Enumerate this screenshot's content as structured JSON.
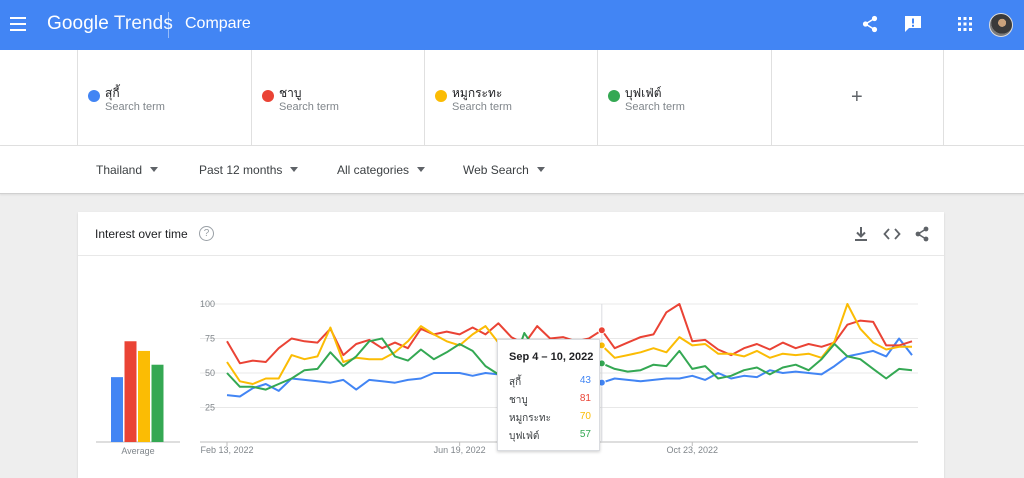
{
  "appbar": {
    "logo_google": "Google",
    "logo_trends": "Trends",
    "title": "Compare"
  },
  "terms": [
    {
      "name": "สุกี้",
      "sub": "Search term",
      "color": "#4285f4"
    },
    {
      "name": "ชาบู",
      "sub": "Search term",
      "color": "#ea4335"
    },
    {
      "name": "หมูกระทะ",
      "sub": "Search term",
      "color": "#fbbc04"
    },
    {
      "name": "บุฟเฟ่ต์",
      "sub": "Search term",
      "color": "#34a853"
    }
  ],
  "add_term_label": "+",
  "filters": {
    "region": "Thailand",
    "period": "Past 12 months",
    "category": "All categories",
    "search_type": "Web Search"
  },
  "card": {
    "title": "Interest over time",
    "help": "?"
  },
  "tooltip": {
    "title": "Sep 4 – 10, 2022",
    "rows": [
      {
        "label": "สุกี้",
        "value": "43",
        "color": "#4285f4"
      },
      {
        "label": "ชาบู",
        "value": "81",
        "color": "#ea4335"
      },
      {
        "label": "หมูกระทะ",
        "value": "70",
        "color": "#fbbc04"
      },
      {
        "label": "บุฟเฟ่ต์",
        "value": "57",
        "color": "#34a853"
      }
    ]
  },
  "chart_data": {
    "type": "line",
    "y_ticks": [
      "100",
      "75",
      "50",
      "25"
    ],
    "ylim": [
      0,
      100
    ],
    "x_tick_labels": [
      "Feb 13, 2022",
      "Jun 19, 2022",
      "Oct 23, 2022"
    ],
    "x_tick_index": [
      0,
      18,
      36
    ],
    "highlight_index": 29,
    "series": [
      {
        "name": "สุกี้",
        "color": "#4285f4",
        "values": [
          34,
          33,
          39,
          42,
          37,
          46,
          45,
          44,
          43,
          45,
          38,
          45,
          44,
          43,
          45,
          46,
          50,
          50,
          50,
          48,
          50,
          49,
          52,
          48,
          47,
          45,
          44,
          43,
          45,
          43,
          46,
          45,
          44,
          45,
          46,
          46,
          48,
          45,
          50,
          46,
          48,
          47,
          52,
          50,
          51,
          50,
          49,
          55,
          62,
          64,
          66,
          62,
          75,
          63
        ]
      },
      {
        "name": "ชาบู",
        "color": "#ea4335",
        "values": [
          73,
          57,
          59,
          58,
          68,
          75,
          73,
          72,
          82,
          63,
          71,
          74,
          68,
          72,
          68,
          82,
          78,
          80,
          78,
          83,
          78,
          86,
          76,
          71,
          84,
          75,
          76,
          73,
          75,
          81,
          68,
          72,
          76,
          78,
          94,
          100,
          73,
          74,
          67,
          63,
          68,
          71,
          67,
          72,
          68,
          71,
          69,
          72,
          85,
          88,
          87,
          70,
          70,
          73
        ]
      },
      {
        "name": "หมูกระทะ",
        "color": "#fbbc04",
        "values": [
          58,
          44,
          42,
          46,
          46,
          63,
          60,
          62,
          83,
          58,
          61,
          60,
          60,
          65,
          73,
          84,
          78,
          73,
          70,
          78,
          84,
          72,
          70,
          68,
          69,
          73,
          72,
          70,
          72,
          70,
          61,
          63,
          65,
          68,
          65,
          76,
          70,
          71,
          64,
          64,
          62,
          66,
          61,
          64,
          63,
          64,
          61,
          73,
          100,
          82,
          72,
          67,
          69,
          69
        ]
      },
      {
        "name": "บุฟเฟ่ต์",
        "color": "#34a853",
        "values": [
          50,
          40,
          40,
          38,
          42,
          46,
          52,
          53,
          65,
          55,
          62,
          73,
          75,
          62,
          59,
          67,
          60,
          65,
          71,
          66,
          55,
          49,
          52,
          79,
          65,
          60,
          58,
          55,
          57,
          57,
          53,
          51,
          52,
          56,
          55,
          66,
          53,
          55,
          46,
          48,
          52,
          54,
          49,
          54,
          56,
          52,
          60,
          71,
          62,
          60,
          53,
          46,
          53,
          52
        ]
      }
    ],
    "mini_bars": {
      "label": "Average",
      "values": [
        47,
        73,
        66,
        56
      ]
    }
  }
}
